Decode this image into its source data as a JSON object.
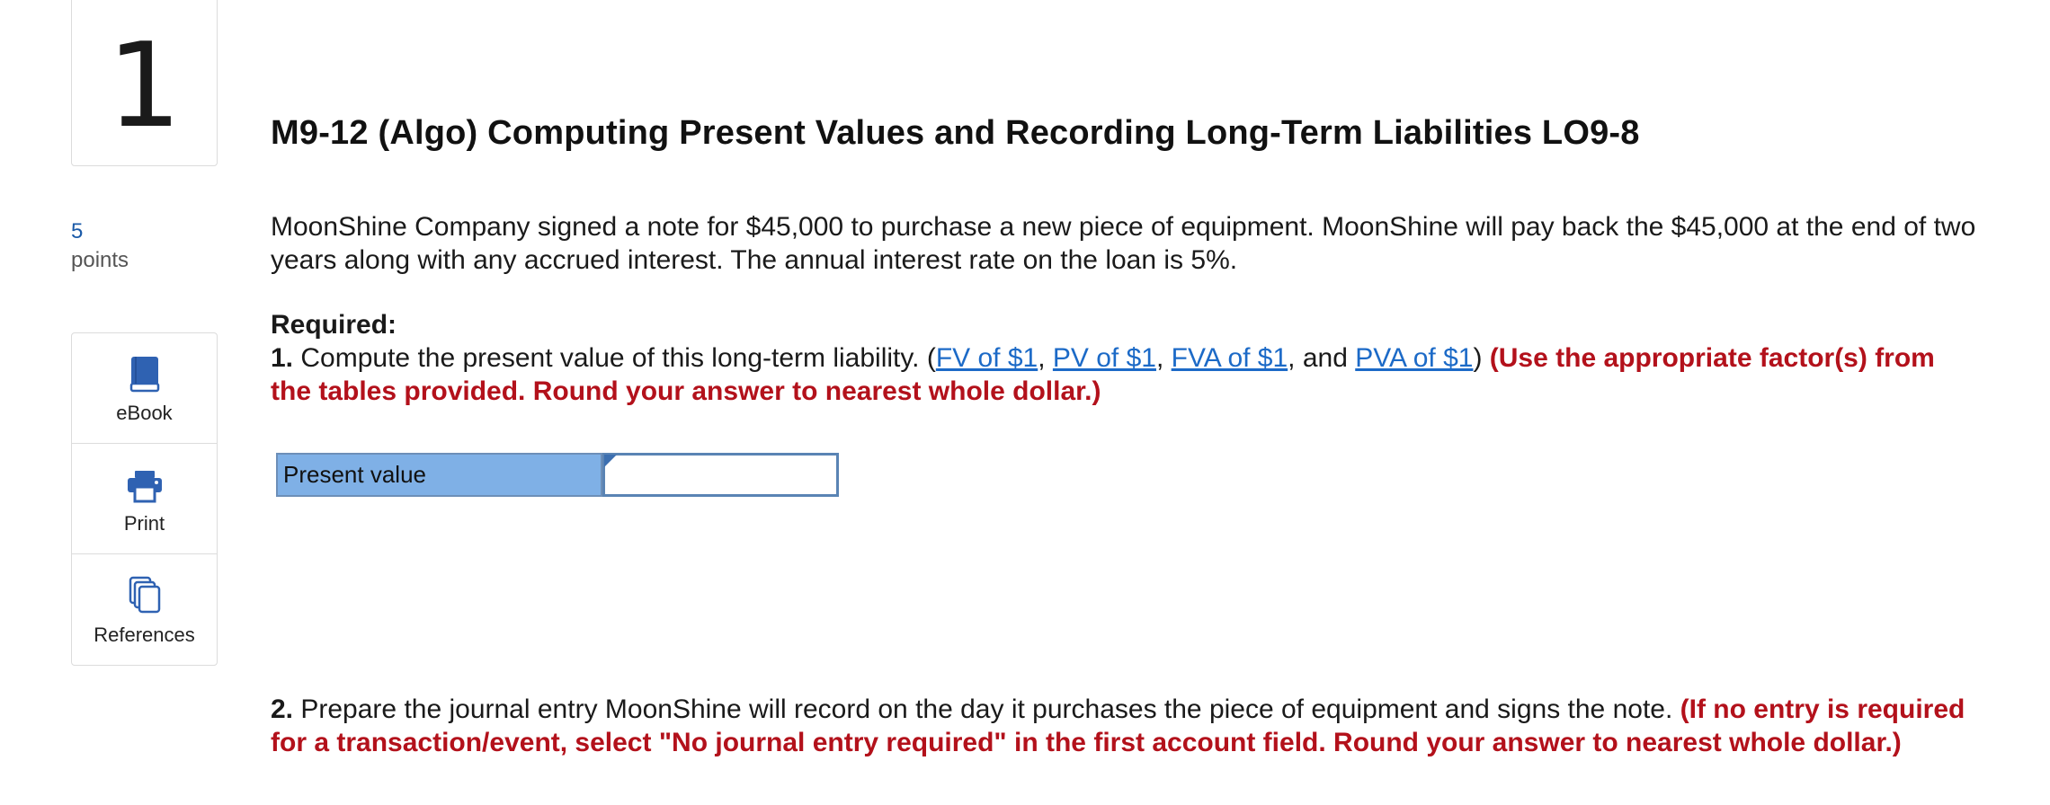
{
  "question": {
    "number": "1",
    "points_value": "5",
    "points_label": "points",
    "title": "M9-12 (Algo) Computing Present Values and Recording Long-Term Liabilities LO9-8"
  },
  "tools": [
    {
      "label": "eBook",
      "icon": "book-icon"
    },
    {
      "label": "Print",
      "icon": "printer-icon"
    },
    {
      "label": "References",
      "icon": "documents-icon"
    }
  ],
  "problem": {
    "text": "MoonShine Company signed a note for $45,000 to purchase a new piece of equipment. MoonShine will pay back the $45,000 at the end of two years along with any accrued interest. The annual interest rate on the loan is 5%.",
    "required_label": "Required:",
    "part1": {
      "number": "1.",
      "text": "Compute the present value of this long-term liability. (",
      "links": [
        "FV of $1",
        "PV of $1",
        "FVA of $1",
        "PVA of $1"
      ],
      "sep1": ", ",
      "sep2": ", ",
      "sep3": ", and ",
      "close": ") ",
      "instruction": "(Use the appropriate factor(s) from the tables provided. Round your answer to nearest whole dollar.)"
    },
    "present_value_label": "Present value",
    "present_value_input": "",
    "part2": {
      "number": "2.",
      "text": "Prepare the journal entry MoonShine will record on the day it purchases the piece of equipment and signs the note. ",
      "instruction": "(If no entry is required for a transaction/event, select \"No journal entry required\" in the first account field. Round your answer to nearest whole dollar.)"
    }
  },
  "colors": {
    "link": "#1c6ac7",
    "instruction_red": "#b3111b",
    "table_header": "#7fb0e6",
    "points_blue": "#1a5aa8"
  }
}
